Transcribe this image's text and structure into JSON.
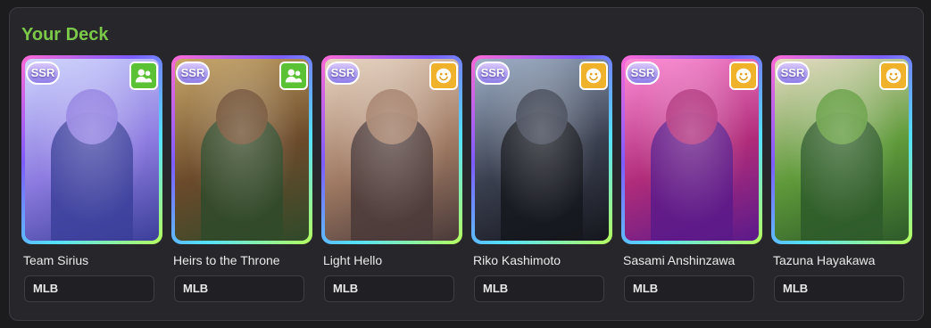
{
  "deck": {
    "title": "Your Deck",
    "title_color": "#7cc94a",
    "cards": [
      {
        "name": "Team Sirius",
        "rarity": "SSR",
        "type_icon": "group-icon",
        "type_color": "#5bc236",
        "limit_break": "MLB",
        "frame_colors": [
          "#ff6ad5",
          "#7c5cff",
          "#53e0ff",
          "#b7ff5a"
        ],
        "art_colors": [
          "#cfd6ff",
          "#8d7be0",
          "#3b3f9a"
        ]
      },
      {
        "name": "Heirs to the Throne",
        "rarity": "SSR",
        "type_icon": "group-icon",
        "type_color": "#5bc236",
        "limit_break": "MLB",
        "frame_colors": [
          "#ff6ad5",
          "#7c5cff",
          "#53e0ff",
          "#b7ff5a"
        ],
        "art_colors": [
          "#c9a86a",
          "#6b4a2b",
          "#2f4a2a"
        ]
      },
      {
        "name": "Light Hello",
        "rarity": "SSR",
        "type_icon": "smile-icon",
        "type_color": "#f0b12b",
        "limit_break": "MLB",
        "frame_colors": [
          "#ff6ad5",
          "#7c5cff",
          "#53e0ff",
          "#b7ff5a"
        ],
        "art_colors": [
          "#e9d6c4",
          "#a07a63",
          "#4a3a3a"
        ]
      },
      {
        "name": "Riko Kashimoto",
        "rarity": "SSR",
        "type_icon": "smile-icon",
        "type_color": "#f0b12b",
        "limit_break": "MLB",
        "frame_colors": [
          "#ff6ad5",
          "#7c5cff",
          "#53e0ff",
          "#b7ff5a"
        ],
        "art_colors": [
          "#9fb1c9",
          "#3a3f4f",
          "#15171d"
        ]
      },
      {
        "name": "Sasami Anshinzawa",
        "rarity": "SSR",
        "type_icon": "smile-icon",
        "type_color": "#f0b12b",
        "limit_break": "MLB",
        "frame_colors": [
          "#ff6ad5",
          "#7c5cff",
          "#53e0ff",
          "#b7ff5a"
        ],
        "art_colors": [
          "#ff8fd8",
          "#b02c7a",
          "#5a1a8a"
        ]
      },
      {
        "name": "Tazuna Hayakawa",
        "rarity": "SSR",
        "type_icon": "smile-icon",
        "type_color": "#f0b12b",
        "limit_break": "MLB",
        "frame_colors": [
          "#ff6ad5",
          "#7c5cff",
          "#53e0ff",
          "#b7ff5a"
        ],
        "art_colors": [
          "#e7dcc4",
          "#5f9a3a",
          "#2e5a2a"
        ]
      }
    ]
  }
}
